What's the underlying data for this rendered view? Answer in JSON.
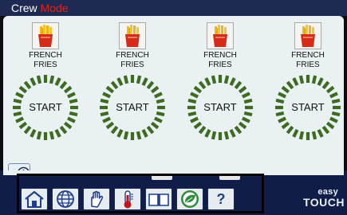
{
  "header": {
    "title_primary": "Crew",
    "title_mode": "Mode"
  },
  "lanes": [
    {
      "product": "FRENCH\nFRIES",
      "action": "START"
    },
    {
      "product": "FRENCH\nFRIES",
      "action": "START"
    },
    {
      "product": "FRENCH\nFRIES",
      "action": "START"
    },
    {
      "product": "FRENCH\nFRIES",
      "action": "START"
    }
  ],
  "toolbar": {
    "help_label": "?",
    "buttons": [
      "home-icon",
      "globe-icon",
      "hand-icon",
      "thermometer-icon",
      "book-icon",
      "leaf-icon",
      "help-icon"
    ]
  },
  "brand": {
    "line1": "easy",
    "line2": "TOUCH"
  },
  "colors": {
    "title_bar": "#1f2a52",
    "mode_text": "#e8201a",
    "panel": "#eaf1f2",
    "start_ring": "#3d6b22",
    "bottom_bar": "#0f1d48",
    "leaf_green": "#2e8a3c",
    "thermometer_red": "#c0151c"
  }
}
